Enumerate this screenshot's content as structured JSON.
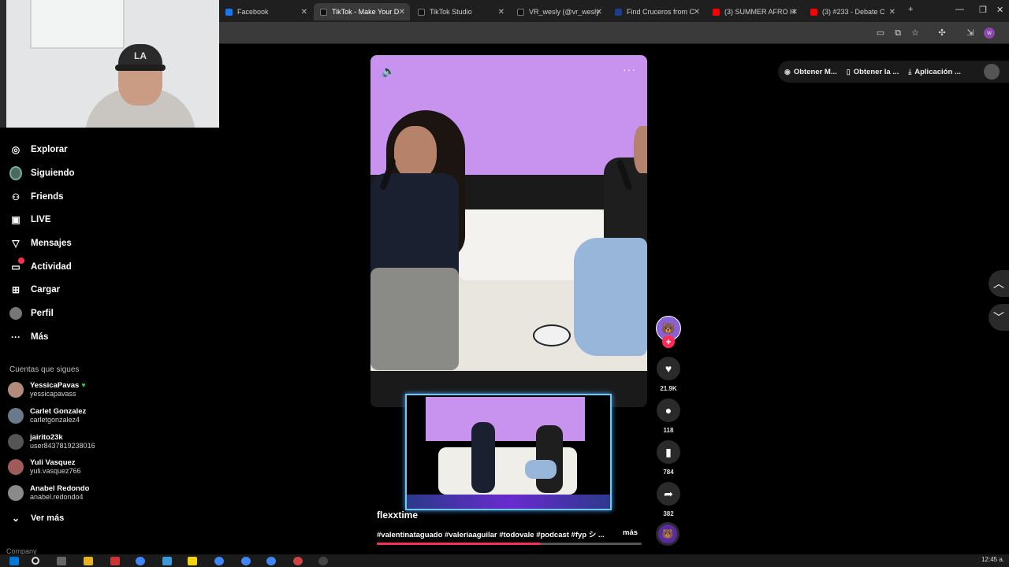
{
  "browser": {
    "tabs": [
      {
        "label": "Facebook",
        "favicon_color": "#1877f2",
        "active": false
      },
      {
        "label": "TikTok - Make Your D",
        "favicon_color": "#111111",
        "active": true
      },
      {
        "label": "TikTok Studio",
        "favicon_color": "#111111",
        "active": false
      },
      {
        "label": "VR_wesly (@vr_wesly",
        "favicon_color": "#111111",
        "active": false
      },
      {
        "label": "Find Cruceros from C",
        "favicon_color": "#1d3d8f",
        "active": false
      },
      {
        "label": "(3) SUMMER AFRO H",
        "favicon_color": "#ff0000",
        "active": false
      },
      {
        "label": "(3) #233 - Debate C",
        "favicon_color": "#ff0000",
        "active": false
      }
    ],
    "new_tab": "+",
    "minimize": "—",
    "maximize": "❐",
    "close": "✕"
  },
  "webcam": {
    "cap_text": "LA"
  },
  "sidebar": {
    "nav": [
      {
        "label": "Explorar",
        "icon": "compass-icon",
        "glyph": "◎"
      },
      {
        "label": "Siguiendo",
        "icon": "following-icon",
        "glyph": "●"
      },
      {
        "label": "Friends",
        "icon": "friends-icon",
        "glyph": "👥"
      },
      {
        "label": "LIVE",
        "icon": "live-icon",
        "glyph": "▣"
      },
      {
        "label": "Mensajes",
        "icon": "messages-icon",
        "glyph": "▽"
      },
      {
        "label": "Actividad",
        "icon": "activity-icon",
        "glyph": "▭"
      },
      {
        "label": "Cargar",
        "icon": "upload-icon",
        "glyph": "⊞"
      },
      {
        "label": "Perfil",
        "icon": "profile-icon",
        "glyph": "●"
      },
      {
        "label": "Más",
        "icon": "more-icon",
        "glyph": "···"
      }
    ],
    "following_title": "Cuentas que sigues",
    "accounts": [
      {
        "name": "YessicaPavas",
        "handle": "yessicapavass",
        "verified": "♥",
        "color": "#b48a7a"
      },
      {
        "name": "Carlet Gonzalez",
        "handle": "carletgonzalez4",
        "verified": "",
        "color": "#6a7a8a"
      },
      {
        "name": "jairito23k",
        "handle": "user8437819238016",
        "verified": "",
        "color": "#555555"
      },
      {
        "name": "Yuli Vasquez",
        "handle": "yuli.vasquez766",
        "verified": "",
        "color": "#a05a5a"
      },
      {
        "name": "Anabel Redondo",
        "handle": "anabel.redondo4",
        "verified": "",
        "color": "#8a8a8a"
      }
    ],
    "see_more": "Ver más",
    "see_more_icon": "⌄",
    "company": "Company"
  },
  "video": {
    "sound_icon": "🔈",
    "more_icon": "···"
  },
  "actions": {
    "likes": "21.9K",
    "comments": "118",
    "saves": "784",
    "shares": "382",
    "like_glyph": "♥",
    "comment_glyph": "●",
    "save_glyph": "▮",
    "share_glyph": "➦",
    "follow_glyph": "+"
  },
  "post": {
    "username": "flexxtime",
    "caption": "#valentinataguado #valeriaaguilar #todovale #podcast #fyp シ ...",
    "more": "más",
    "progress": 0.62
  },
  "topbar": {
    "pills": [
      {
        "label": "Obtener M...",
        "glyph": "◉"
      },
      {
        "label": "Obtener la ...",
        "glyph": "▯"
      },
      {
        "label": "Aplicación ...",
        "glyph": "⤓"
      }
    ]
  },
  "feed_nav": {
    "up": "︿",
    "down": "﹀"
  },
  "taskbar": {
    "clock": "12:45 a."
  }
}
